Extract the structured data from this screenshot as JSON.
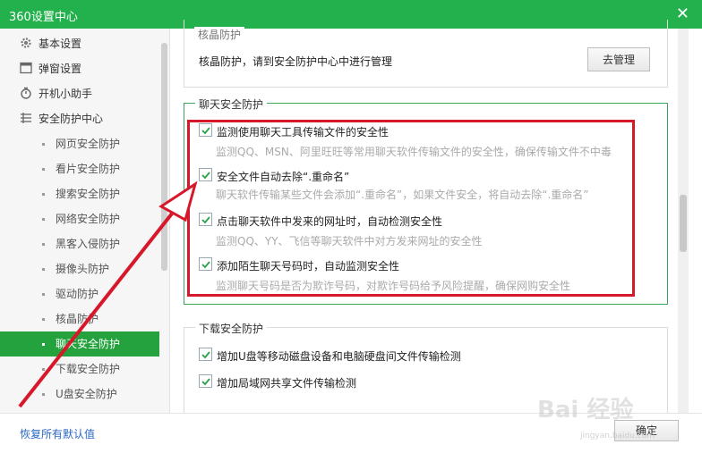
{
  "window": {
    "title": "360设置中心",
    "close_glyph": "✕"
  },
  "sidebar": {
    "items": [
      {
        "label": "基本设置",
        "icon": "gear-icon"
      },
      {
        "label": "弹窗设置",
        "icon": "window-icon"
      },
      {
        "label": "开机小助手",
        "icon": "timer-icon"
      },
      {
        "label": "安全防护中心",
        "icon": "shield-grid-icon"
      }
    ],
    "sub_items": [
      {
        "label": "网页安全防护"
      },
      {
        "label": "看片安全防护"
      },
      {
        "label": "搜索安全防护"
      },
      {
        "label": "网络安全防护"
      },
      {
        "label": "黑客入侵防护"
      },
      {
        "label": "摄像头防护"
      },
      {
        "label": "驱动防护"
      },
      {
        "label": "核晶防护"
      },
      {
        "label": "聊天安全防护",
        "active": true
      },
      {
        "label": "下载安全防护"
      },
      {
        "label": "U盘安全防护"
      }
    ]
  },
  "main": {
    "core_section": {
      "title": "核晶防护",
      "text": "核晶防护，请到安全防护中心中进行管理",
      "button": "去管理"
    },
    "chat_section": {
      "title": "聊天安全防护",
      "options": [
        {
          "label": "监测使用聊天工具传输文件的安全性",
          "desc": "监测QQ、MSN、阿里旺旺等常用聊天软件传输文件的安全性，确保传输文件不中毒",
          "checked": true
        },
        {
          "label": "安全文件自动去除“.重命名”",
          "desc": "聊天软件传输某些文件会添加“.重命名”，如果文件安全，将自动去除“.重命名”",
          "checked": true
        },
        {
          "label": "点击聊天软件中发来的网址时，自动检测安全性",
          "desc": "监测QQ、YY、飞信等聊天软件中对方发来网址的安全性",
          "checked": true
        },
        {
          "label": "添加陌生聊天号码时，自动监测安全性",
          "desc": "监测聊天号码是否为欺诈号码，对欺诈号码给予风险提醒，确保网购安全性",
          "checked": true
        }
      ]
    },
    "download_section": {
      "title": "下载安全防护",
      "options": [
        {
          "label": "增加U盘等移动磁盘设备和电脑硬盘间文件传输检测",
          "checked": true
        },
        {
          "label": "增加局域网共享文件传输检测",
          "checked": true
        }
      ]
    }
  },
  "footer": {
    "reset_link": "恢复所有默认值",
    "ok_button": "确定"
  },
  "watermark": {
    "main": "Bai 经验",
    "sub": "jingyan.baidu.com"
  },
  "colors": {
    "brand_green": "#23b14d",
    "active_green": "#23a23d",
    "highlight_red": "#d7182a",
    "link_blue": "#2b68c4"
  }
}
